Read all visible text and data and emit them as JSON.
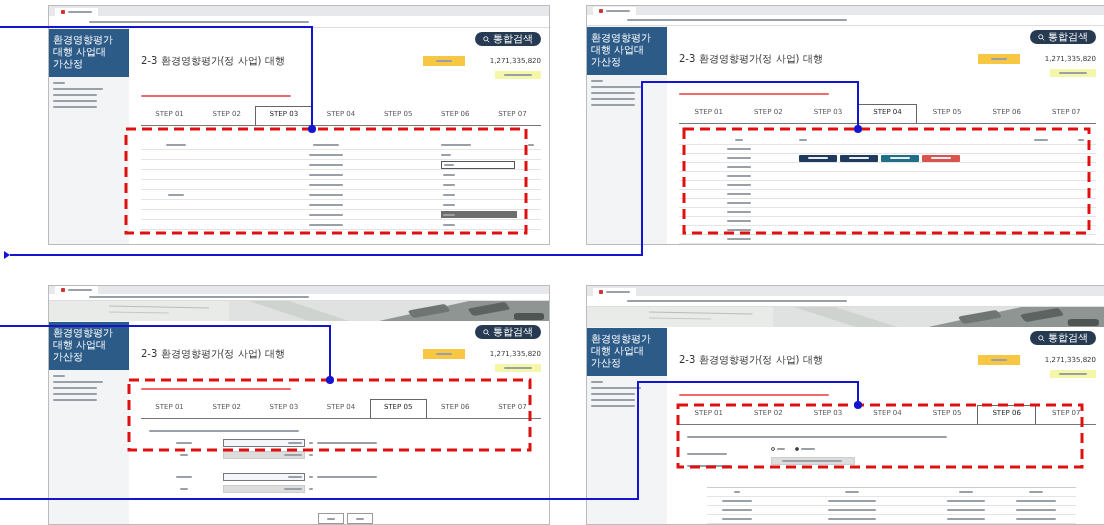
{
  "panels": [
    {
      "banner": false,
      "search": "통합검색",
      "sidebar_title": "환경영향평가 대행 사업대가산정",
      "page_title": "2-3 환경영향평가(정 사업) 대행",
      "amount": "1,271,335,820",
      "steps": [
        {
          "label": "STEP 01",
          "selected": false
        },
        {
          "label": "STEP 02",
          "selected": false
        },
        {
          "label": "STEP 03",
          "selected": true
        },
        {
          "label": "STEP 04",
          "selected": false
        },
        {
          "label": "STEP 05",
          "selected": false
        },
        {
          "label": "STEP 06",
          "selected": false
        },
        {
          "label": "STEP 07",
          "selected": false
        }
      ],
      "content": {
        "kind": "dropdown-table",
        "options": [
          {
            "selected": false
          },
          {
            "selected": false
          },
          {
            "selected": false
          },
          {
            "selected": false
          },
          {
            "selected": true
          },
          {
            "selected": false
          }
        ]
      }
    },
    {
      "banner": false,
      "search": "통합검색",
      "sidebar_title": "환경영향평가 대행 사업대가산정",
      "page_title": "2-3 환경영향평가(정 사업) 대행",
      "amount": "1,271,335,820",
      "steps": [
        {
          "label": "STEP 01",
          "selected": false
        },
        {
          "label": "STEP 02",
          "selected": false
        },
        {
          "label": "STEP 03",
          "selected": false
        },
        {
          "label": "STEP 04",
          "selected": true
        },
        {
          "label": "STEP 05",
          "selected": false
        },
        {
          "label": "STEP 06",
          "selected": false
        },
        {
          "label": "STEP 07",
          "selected": false
        }
      ],
      "content": {
        "kind": "button-table",
        "buttons": [
          {
            "color": "#1f3a5f"
          },
          {
            "color": "#1f3a5f"
          },
          {
            "color": "#1f6f86"
          },
          {
            "color": "#d9534f"
          }
        ]
      }
    },
    {
      "banner": true,
      "search": "통합검색",
      "sidebar_title": "환경영향평가 대행 사업대가산정",
      "page_title": "2-3 환경영향평가(정 사업) 대행",
      "amount": "1,271,335,820",
      "steps": [
        {
          "label": "STEP 01",
          "selected": false
        },
        {
          "label": "STEP 02",
          "selected": false
        },
        {
          "label": "STEP 03",
          "selected": false
        },
        {
          "label": "STEP 04",
          "selected": false
        },
        {
          "label": "STEP 05",
          "selected": true
        },
        {
          "label": "STEP 06",
          "selected": false
        },
        {
          "label": "STEP 07",
          "selected": false
        }
      ],
      "content": {
        "kind": "rate-form"
      }
    },
    {
      "banner": true,
      "search": "통합검색",
      "sidebar_title": "환경영향평가 대행 사업대가산정",
      "page_title": "2-3 환경영향평가(정 사업) 대행",
      "amount": "1,271,335,820",
      "steps": [
        {
          "label": "STEP 01",
          "selected": false
        },
        {
          "label": "STEP 02",
          "selected": false
        },
        {
          "label": "STEP 03",
          "selected": false
        },
        {
          "label": "STEP 04",
          "selected": false
        },
        {
          "label": "STEP 05",
          "selected": false
        },
        {
          "label": "STEP 06",
          "selected": true
        },
        {
          "label": "STEP 07",
          "selected": false
        }
      ],
      "content": {
        "kind": "radio-form",
        "radios": [
          {
            "selected": false
          },
          {
            "selected": true
          }
        ]
      }
    }
  ]
}
